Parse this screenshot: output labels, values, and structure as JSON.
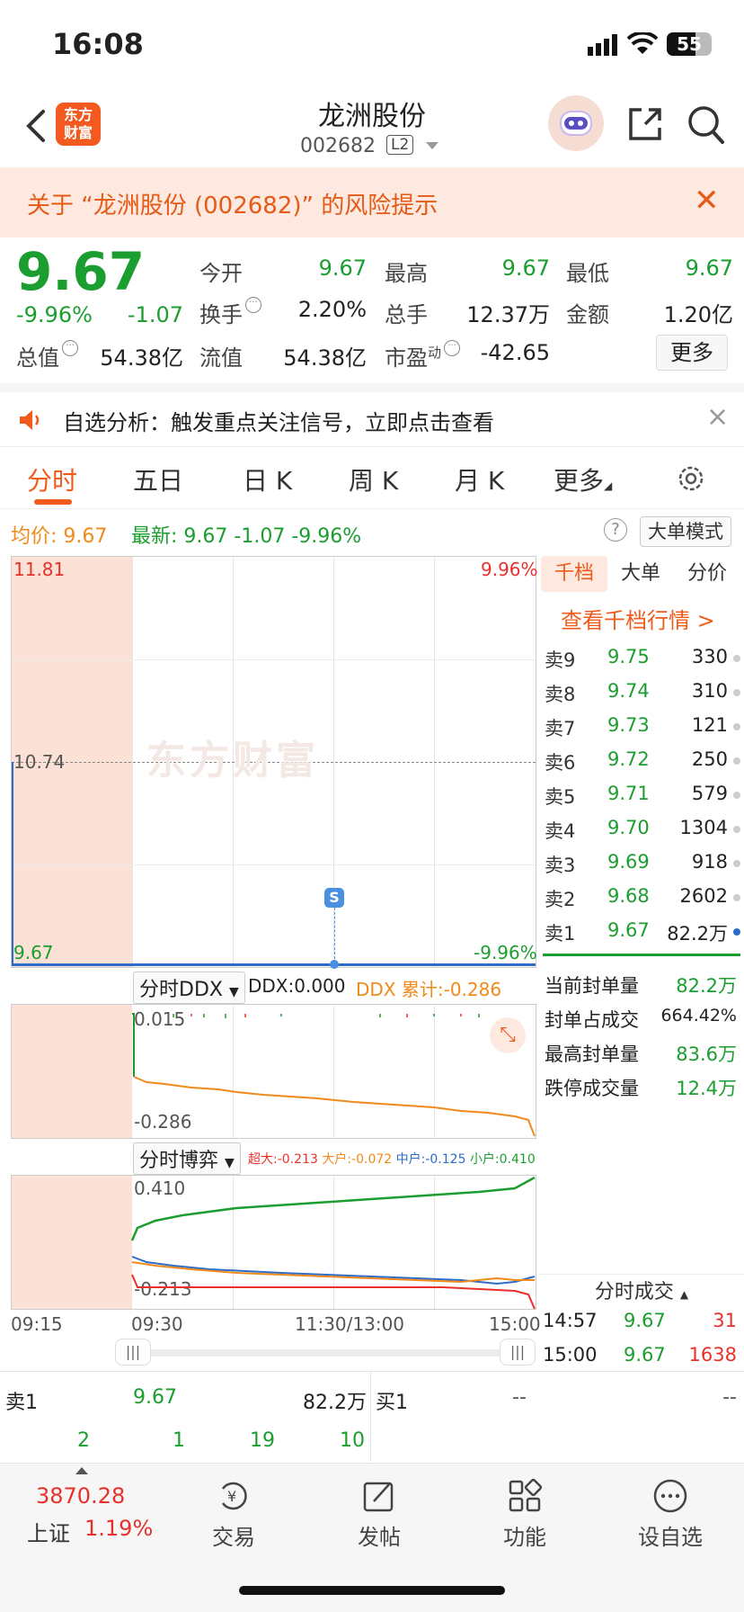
{
  "status": {
    "time": "16:08",
    "battery": "55"
  },
  "header": {
    "logo": "东方财富",
    "name": "龙洲股份",
    "code": "002682",
    "level": "L2"
  },
  "risk_banner": {
    "text": "关于 “龙洲股份 (002682)” 的风险提示"
  },
  "quote": {
    "price": "9.67",
    "change_pct": "-9.96%",
    "change": "-1.07",
    "open_label": "今开",
    "open": "9.67",
    "high_label": "最高",
    "high": "9.67",
    "low_label": "最低",
    "low": "9.67",
    "turnover_label": "换手",
    "turnover": "2.20%",
    "volume_label": "总手",
    "volume": "12.37万",
    "amount_label": "金额",
    "amount": "1.20亿",
    "mktcap_label": "总值",
    "mktcap": "54.38亿",
    "float_label": "流值",
    "float": "54.38亿",
    "pe_label": "市盈",
    "pe_sup": "动",
    "pe": "-42.65",
    "more": "更多"
  },
  "notice": {
    "text": "自选分析：触发重点关注信号，立即点击查看"
  },
  "tabs": [
    "分时",
    "五日",
    "日 K",
    "周 K",
    "月 K",
    "更多"
  ],
  "avg": {
    "avg_label": "均价:",
    "avg": "9.67",
    "latest_label": "最新:",
    "latest": "9.67",
    "chg": "-1.07",
    "pct": "-9.96%",
    "big_order": "大单模式"
  },
  "main_chart": {
    "y_top": "11.81",
    "y_mid": "10.74",
    "y_bottom": "9.67",
    "pct_top": "9.96%",
    "pct_bottom": "-9.96%",
    "marker": "S",
    "watermark": "东方财富"
  },
  "ddx": {
    "selector": "分时DDX",
    "ddx_label": "DDX:",
    "ddx": "0.000",
    "cum_label": "DDX 累计:",
    "cum": "-0.286",
    "y_top": "0.015",
    "y_bottom": "-0.286"
  },
  "game": {
    "selector": "分时博弈",
    "super_label": "超大:",
    "super": "-0.213",
    "big_label": "大户:",
    "big": "-0.072",
    "mid_label": "中户:",
    "mid": "-0.125",
    "small_label": "小户:",
    "small": "0.410",
    "y_top": "0.410",
    "y_bottom": "-0.213"
  },
  "time_axis": [
    "09:15",
    "09:30",
    "11:30/13:00",
    "15:00"
  ],
  "book": {
    "tabs": [
      "千档",
      "大单",
      "分价"
    ],
    "link": "查看千档行情 >",
    "asks": [
      {
        "label": "卖9",
        "price": "9.75",
        "vol": "330"
      },
      {
        "label": "卖8",
        "price": "9.74",
        "vol": "310"
      },
      {
        "label": "卖7",
        "price": "9.73",
        "vol": "121"
      },
      {
        "label": "卖6",
        "price": "9.72",
        "vol": "250"
      },
      {
        "label": "卖5",
        "price": "9.71",
        "vol": "579"
      },
      {
        "label": "卖4",
        "price": "9.70",
        "vol": "1304"
      },
      {
        "label": "卖3",
        "price": "9.69",
        "vol": "918"
      },
      {
        "label": "卖2",
        "price": "9.68",
        "vol": "2602"
      },
      {
        "label": "卖1",
        "price": "9.67",
        "vol": "82.2万"
      }
    ],
    "stats": [
      {
        "label": "当前封单量",
        "value": "82.2万"
      },
      {
        "label": "封单占成交",
        "value": "664.42%"
      },
      {
        "label": "最高封单量",
        "value": "83.6万"
      },
      {
        "label": "跌停成交量",
        "value": "12.4万"
      }
    ],
    "trades_title": "分时成交",
    "trades": [
      {
        "time": "14:57",
        "price": "9.67",
        "vol": "31"
      },
      {
        "time": "15:00",
        "price": "9.67",
        "vol": "1638"
      }
    ]
  },
  "bottom": {
    "sell_label": "卖1",
    "sell_price": "9.67",
    "sell_vol": "82.2万",
    "buy_label": "买1",
    "buy_price": "--",
    "buy_vol": "--",
    "counts": [
      "2",
      "1",
      "19",
      "10"
    ]
  },
  "tabbar": {
    "index_value": "3870.28",
    "index_name": "上证",
    "index_pct": "1.19%",
    "items": [
      "交易",
      "发帖",
      "功能",
      "设自选"
    ]
  },
  "colors": {
    "up": "#e8312b",
    "down": "#1b9e2f",
    "accent": "#f05a1a",
    "avg_line": "#f08a1a"
  }
}
